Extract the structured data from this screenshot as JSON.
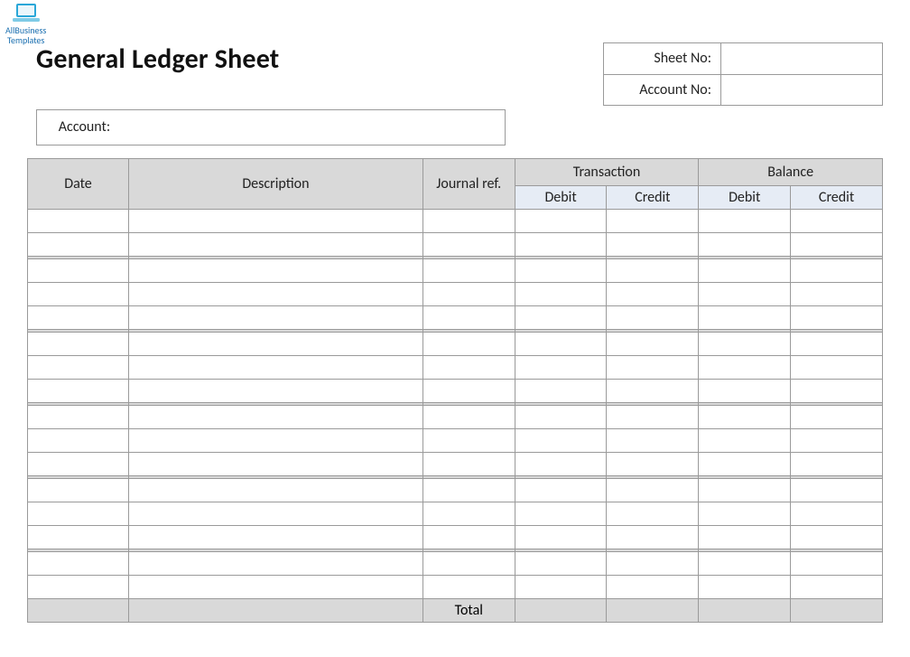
{
  "brand": {
    "line1": "AllBusiness",
    "line2": "Templates"
  },
  "title": "General Ledger Sheet",
  "info": {
    "sheet_no_label": "Sheet No:",
    "sheet_no_value": "",
    "account_no_label": "Account No:",
    "account_no_value": ""
  },
  "account": {
    "label": "Account:",
    "value": ""
  },
  "columns": {
    "date": "Date",
    "description": "Description",
    "journal_ref": "Journal ref.",
    "transaction": "Transaction",
    "balance": "Balance",
    "debit": "Debit",
    "credit": "Credit"
  },
  "rows": [
    {
      "date": "",
      "description": "",
      "journal_ref": "",
      "t_debit": "",
      "t_credit": "",
      "b_debit": "",
      "b_credit": ""
    },
    {
      "date": "",
      "description": "",
      "journal_ref": "",
      "t_debit": "",
      "t_credit": "",
      "b_debit": "",
      "b_credit": ""
    },
    {
      "date": "",
      "description": "",
      "journal_ref": "",
      "t_debit": "",
      "t_credit": "",
      "b_debit": "",
      "b_credit": ""
    },
    {
      "date": "",
      "description": "",
      "journal_ref": "",
      "t_debit": "",
      "t_credit": "",
      "b_debit": "",
      "b_credit": ""
    },
    {
      "date": "",
      "description": "",
      "journal_ref": "",
      "t_debit": "",
      "t_credit": "",
      "b_debit": "",
      "b_credit": ""
    },
    {
      "date": "",
      "description": "",
      "journal_ref": "",
      "t_debit": "",
      "t_credit": "",
      "b_debit": "",
      "b_credit": ""
    },
    {
      "date": "",
      "description": "",
      "journal_ref": "",
      "t_debit": "",
      "t_credit": "",
      "b_debit": "",
      "b_credit": ""
    },
    {
      "date": "",
      "description": "",
      "journal_ref": "",
      "t_debit": "",
      "t_credit": "",
      "b_debit": "",
      "b_credit": ""
    },
    {
      "date": "",
      "description": "",
      "journal_ref": "",
      "t_debit": "",
      "t_credit": "",
      "b_debit": "",
      "b_credit": ""
    },
    {
      "date": "",
      "description": "",
      "journal_ref": "",
      "t_debit": "",
      "t_credit": "",
      "b_debit": "",
      "b_credit": ""
    },
    {
      "date": "",
      "description": "",
      "journal_ref": "",
      "t_debit": "",
      "t_credit": "",
      "b_debit": "",
      "b_credit": ""
    },
    {
      "date": "",
      "description": "",
      "journal_ref": "",
      "t_debit": "",
      "t_credit": "",
      "b_debit": "",
      "b_credit": ""
    },
    {
      "date": "",
      "description": "",
      "journal_ref": "",
      "t_debit": "",
      "t_credit": "",
      "b_debit": "",
      "b_credit": ""
    },
    {
      "date": "",
      "description": "",
      "journal_ref": "",
      "t_debit": "",
      "t_credit": "",
      "b_debit": "",
      "b_credit": ""
    },
    {
      "date": "",
      "description": "",
      "journal_ref": "",
      "t_debit": "",
      "t_credit": "",
      "b_debit": "",
      "b_credit": ""
    },
    {
      "date": "",
      "description": "",
      "journal_ref": "",
      "t_debit": "",
      "t_credit": "",
      "b_debit": "",
      "b_credit": ""
    }
  ],
  "group_breaks_after": [
    1,
    4,
    7,
    10,
    13
  ],
  "footer": {
    "total_label": "Total"
  }
}
